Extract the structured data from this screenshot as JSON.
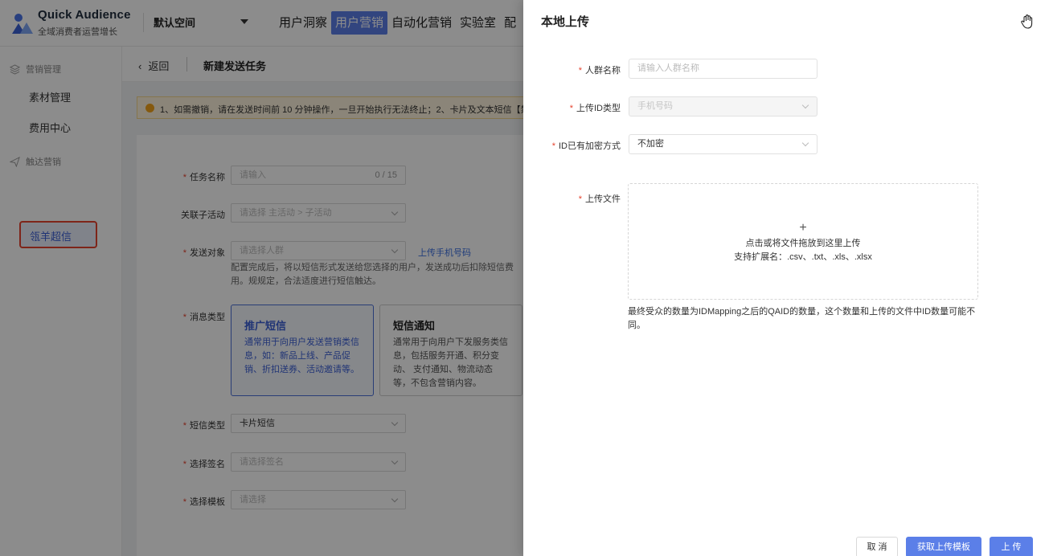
{
  "app": {
    "name": "Quick Audience",
    "subtitle": "全域消费者运营增长",
    "workspace": "默认空间",
    "nav": [
      "用户洞察",
      "用户营销",
      "自动化营销",
      "实验室",
      "配"
    ],
    "nav_active_index": 1
  },
  "sidebar": {
    "groups": [
      {
        "label": "营销管理",
        "icon": "layers-icon",
        "items": [
          "素材管理",
          "费用中心"
        ]
      },
      {
        "label": "触达营销",
        "icon": "send-icon",
        "items": [
          "瓴羊超信"
        ]
      }
    ],
    "active_item": "瓴羊超信"
  },
  "page": {
    "back_label": "返回",
    "title": "新建发送任务",
    "notice": "1、如需撤销，请在发送时间前 10 分钟操作，一旦开始执行无法终止；2、卡片及文本短信【禁",
    "form": {
      "task_name_label": "任务名称",
      "task_name_placeholder": "请输入",
      "task_name_count": "0 / 15",
      "related_activity_label": "关联子活动",
      "related_activity_placeholder": "请选择 主活动 > 子活动",
      "target_label": "发送对象",
      "target_placeholder": "请选择人群",
      "upload_phone_link": "上传手机号码",
      "target_hint": "配置完成后，将以短信形式发送给您选择的用户，发送成功后扣除短信费用。规规定，合法适度进行短信触达。",
      "msg_type_label": "消息类型",
      "msg_types": [
        {
          "title": "推广短信",
          "desc": "通常用于向用户发送营销类信息，如：新品上线、产品促销、折扣送券、活动邀请等。"
        },
        {
          "title": "短信通知",
          "desc": "通常用于向用户下发服务类信息，包括服务开通、积分变动、 支付通知、物流动态等，不包含营销内容。"
        }
      ],
      "sms_type_label": "短信类型",
      "sms_type_value": "卡片短信",
      "signature_label": "选择签名",
      "signature_placeholder": "请选择签名",
      "template_label": "选择模板",
      "template_placeholder": "请选择"
    }
  },
  "drawer": {
    "title": "本地上传",
    "close_icon": "close-icon",
    "fields": {
      "crowd_name_label": "人群名称",
      "crowd_name_placeholder": "请输入人群名称",
      "id_type_label": "上传ID类型",
      "id_type_value": "手机号码",
      "encryption_label": "ID已有加密方式",
      "encryption_value": "不加密",
      "file_label": "上传文件"
    },
    "upload": {
      "plus": "+",
      "line1": "点击或将文件拖放到这里上传",
      "line2": "支持扩展名：.csv、.txt、.xls、.xlsx"
    },
    "note": "最终受众的数量为IDMapping之后的QAID的数量，这个数量和上传的文件中ID数量可能不同。",
    "buttons": {
      "cancel": "取 消",
      "get_template": "获取上传模板",
      "upload": "上 传"
    }
  },
  "colors": {
    "primary": "#5b7fe8",
    "required": "#e5432f",
    "highlight_border": "#e5432f",
    "notice_bg": "#fdf3dc"
  }
}
